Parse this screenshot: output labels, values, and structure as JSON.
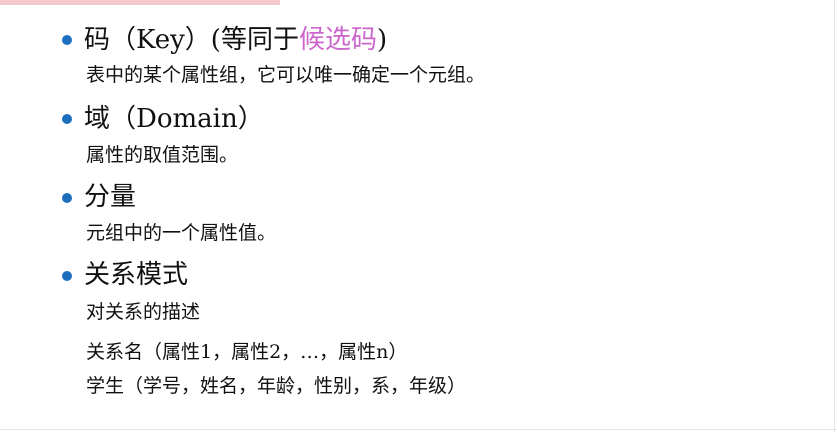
{
  "items": [
    {
      "term_prefix": "码（Key）(等同于",
      "term_highlight": "候选码",
      "term_suffix": ")",
      "details": [
        "表中的某个属性组，它可以唯一确定一个元组。"
      ]
    },
    {
      "term": "域（Domain）",
      "details": [
        "属性的取值范围。"
      ]
    },
    {
      "term": "分量",
      "details": [
        "元组中的一个属性值。"
      ]
    },
    {
      "term": "关系模式",
      "details": [
        "对关系的描述",
        "关系名（属性1，属性2，…，属性n）",
        "学生（学号，姓名，年龄，性别，系，年级）"
      ]
    }
  ],
  "colors": {
    "bullet": "#1e6ebe",
    "highlight": "#cc66cc",
    "accent_bar": "#f5c9c9"
  }
}
